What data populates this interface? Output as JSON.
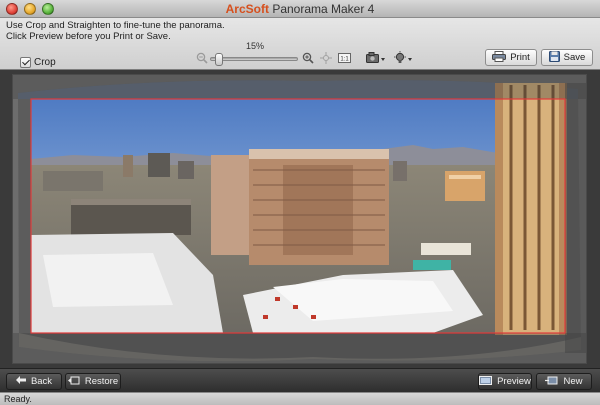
{
  "window": {
    "title_brand": "ArcSoft",
    "title_rest": "Panorama Maker 4"
  },
  "toolbar": {
    "hint_line1": "Use Crop and Straighten to fine-tune the panorama.",
    "hint_line2": "Click Preview before you Print or Save.",
    "crop_label": "Crop",
    "crop_checked": true,
    "zoom_percent": "15%",
    "zoom_level": 0.05,
    "print_label": "Print",
    "save_label": "Save",
    "icons": [
      "zoom-out-icon",
      "zoom-in-icon",
      "fit-icon",
      "actual-size-icon",
      "camera-icon",
      "bulb-icon"
    ]
  },
  "bottombar": {
    "back_label": "Back",
    "restore_label": "Restore",
    "preview_label": "Preview",
    "new_label": "New"
  },
  "status": {
    "text": "Ready."
  },
  "colors": {
    "brand": "#d6501e",
    "crop_frame": "#e23a3a",
    "sky_top": "#5a83c6",
    "sky_bottom": "#a9c4e4"
  }
}
